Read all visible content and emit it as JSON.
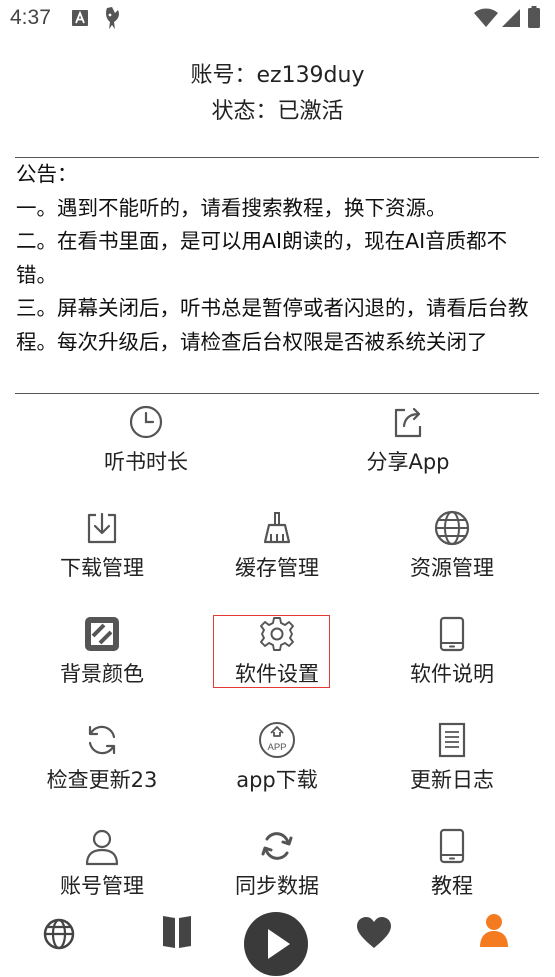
{
  "status_bar": {
    "time": "4:37",
    "icons": [
      "a-notification-icon",
      "bird-notification-icon",
      "wifi-icon",
      "signal-icon",
      "battery-icon"
    ]
  },
  "account": {
    "account_line": "账号：ez139duy",
    "status_line": "状态：已激活"
  },
  "notice": {
    "title": "公告：",
    "lines": [
      "一。遇到不能听的，请看搜索教程，换下资源。",
      "二。在看书里面，是可以用AI朗读的，现在AI音质都不错。",
      "三。屏幕关闭后，听书总是暂停或者闪退的，请看后台教程。每次升级后，请检查后台权限是否被系统关闭了"
    ]
  },
  "menu": {
    "listen_time": "听书时长",
    "share_app": "分享App",
    "download_manage": "下载管理",
    "cache_manage": "缓存管理",
    "source_manage": "资源管理",
    "bg_color": "背景颜色",
    "software_settings": "软件设置",
    "software_info": "软件说明",
    "check_update": "检查更新23",
    "app_download": "app下载",
    "update_log": "更新日志",
    "account_manage": "账号管理",
    "sync_data": "同步数据",
    "tutorial": "教程"
  },
  "app_badge_text": "APP",
  "colors": {
    "accent": "#f47b20",
    "highlight_box": "#e53935",
    "icon_gray": "#555555",
    "play_button": "#3a3a3a"
  },
  "bottom_nav": [
    "globe-icon",
    "book-icon",
    "play-icon",
    "heart-icon",
    "person-icon"
  ]
}
